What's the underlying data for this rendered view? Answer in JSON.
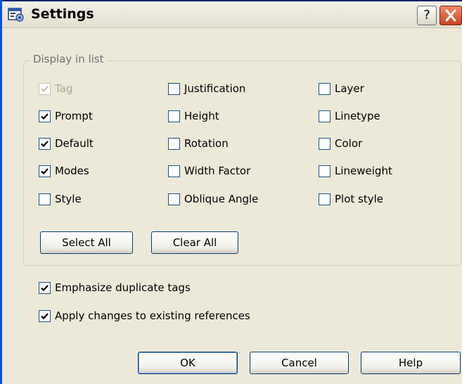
{
  "window": {
    "title": "Settings",
    "help_glyph": "?"
  },
  "group": {
    "legend": "Display in list",
    "checkboxes": [
      {
        "label": "Tag",
        "checked": true,
        "disabled": true
      },
      {
        "label": "Justification",
        "checked": false,
        "disabled": false
      },
      {
        "label": "Layer",
        "checked": false,
        "disabled": false
      },
      {
        "label": "Prompt",
        "checked": true,
        "disabled": false
      },
      {
        "label": "Height",
        "checked": false,
        "disabled": false
      },
      {
        "label": "Linetype",
        "checked": false,
        "disabled": false
      },
      {
        "label": "Default",
        "checked": true,
        "disabled": false
      },
      {
        "label": "Rotation",
        "checked": false,
        "disabled": false
      },
      {
        "label": "Color",
        "checked": false,
        "disabled": false
      },
      {
        "label": "Modes",
        "checked": true,
        "disabled": false
      },
      {
        "label": "Width Factor",
        "checked": false,
        "disabled": false
      },
      {
        "label": "Lineweight",
        "checked": false,
        "disabled": false
      },
      {
        "label": "Style",
        "checked": false,
        "disabled": false
      },
      {
        "label": "Oblique Angle",
        "checked": false,
        "disabled": false
      },
      {
        "label": "Plot style",
        "checked": false,
        "disabled": false
      }
    ],
    "select_all_label": "Select All",
    "clear_all_label": "Clear All"
  },
  "options": {
    "emphasize": {
      "label": "Emphasize duplicate tags",
      "checked": true
    },
    "apply": {
      "label": "Apply changes to existing references",
      "checked": true
    }
  },
  "footer": {
    "ok_label": "OK",
    "cancel_label": "Cancel",
    "help_label": "Help"
  },
  "colors": {
    "title_accent": "#0054E3",
    "checkbox_border": "#1C5180",
    "checkmark": "#21A121",
    "close_button": "#C8441F"
  },
  "icons": {
    "app": "settings-dialog-icon",
    "help": "help-icon",
    "close": "close-icon",
    "check": "checkmark-icon"
  }
}
